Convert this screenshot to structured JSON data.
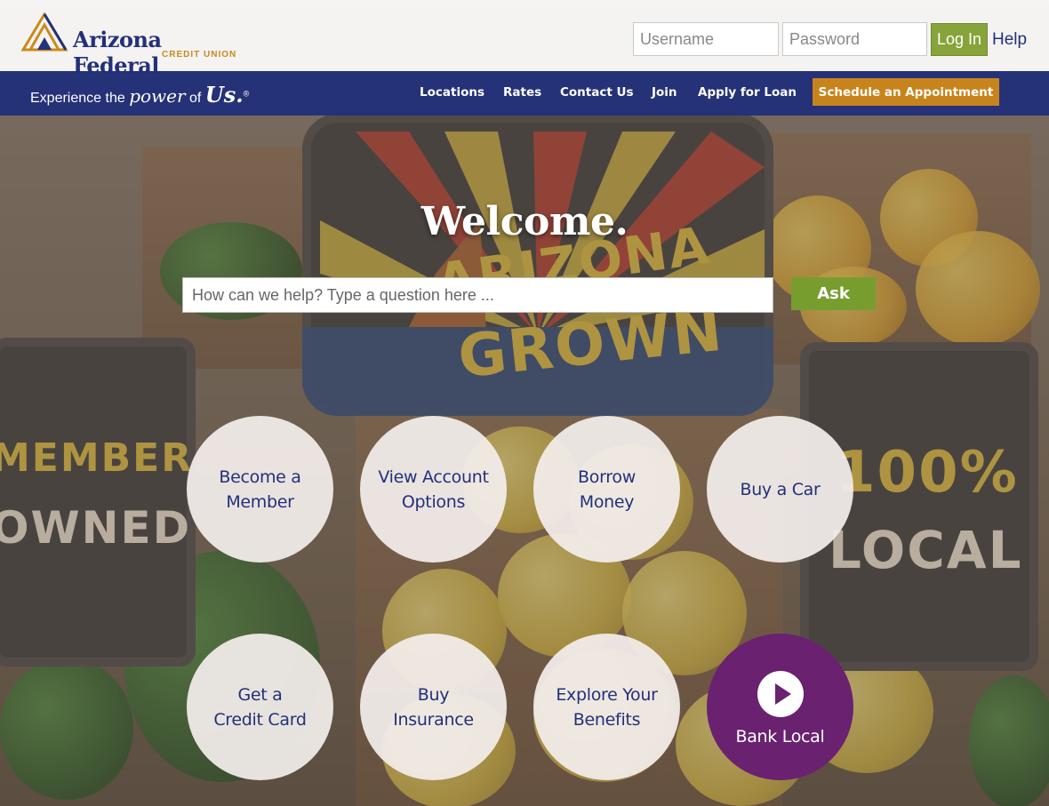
{
  "header": {
    "logo_name": "Arizona Federal",
    "logo_sub": "CREDIT UNION",
    "username_placeholder": "Username",
    "password_placeholder": "Password",
    "login_label": "Log In",
    "help_label": "Help"
  },
  "nav": {
    "tagline_pre": "Experience the ",
    "tagline_power": "power",
    "tagline_of": " of ",
    "tagline_us": "Us.",
    "tagline_mark": "®",
    "links": [
      "Locations",
      "Rates",
      "Contact Us",
      "Join",
      "Apply for Loan"
    ],
    "cta_label": "Schedule an Appointment"
  },
  "hero": {
    "title": "Welcome.",
    "search_placeholder": "How can we help? Type a question here ...",
    "ask_label": "Ask",
    "background_signs": {
      "left_top": "MEMBER",
      "left_bottom": "OWNED",
      "center_top": "ARIZONA",
      "center_bottom": "GROWN",
      "right_top": "100%",
      "right_bottom": "LOCAL"
    }
  },
  "actions": {
    "row1": [
      "Become a\nMember",
      "View Account\nOptions",
      "Borrow\nMoney",
      "Buy a Car"
    ],
    "row2": [
      "Get a\nCredit Card",
      "Buy\nInsurance",
      "Explore Your\nBenefits"
    ],
    "bank_local_label": "Bank Local"
  },
  "colors": {
    "brand_navy": "#23307a",
    "brand_gold": "#c8841c",
    "brand_green": "#86a43a",
    "brand_purple": "#6a2170"
  }
}
